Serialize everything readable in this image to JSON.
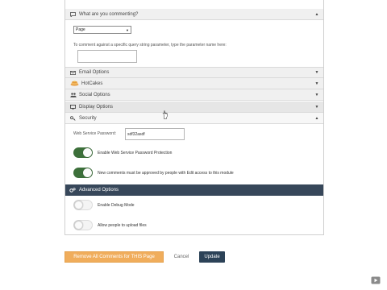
{
  "sections": {
    "commenting": {
      "label": "What are you commenting?",
      "icon": "comment-icon",
      "caret": "▲"
    },
    "email": {
      "label": "Email Options",
      "icon": "envelope-icon",
      "caret": "▼"
    },
    "hotcakes": {
      "label": "HotCakes",
      "icon": "hotcakes-logo-icon",
      "caret": "▼"
    },
    "social": {
      "label": "Social Options",
      "icon": "users-icon",
      "caret": "▼"
    },
    "display": {
      "label": "Display Options",
      "icon": "monitor-icon",
      "caret": "▼"
    },
    "security": {
      "label": "Security",
      "icon": "key-icon",
      "caret": "▲"
    }
  },
  "commenting": {
    "select_value": "Page",
    "help_text": "To comment against a specific query string parameter, type the parameter name here:",
    "param_value": ""
  },
  "security": {
    "password_label": "Web Service Password:",
    "password_value": "sdf32asdf",
    "toggles": [
      {
        "label": "Enable Web Service Password Protection",
        "on": true
      },
      {
        "label": "New comments must be approved by people with Edit access to this module",
        "on": true
      }
    ]
  },
  "advanced": {
    "label": "Advanced Options",
    "icon": "gears-icon",
    "toggles": [
      {
        "label": "Enable Debug Mode",
        "on": false
      },
      {
        "label": "Allow people to upload files",
        "on": false
      }
    ]
  },
  "actions": {
    "remove_label": "Remove All Comments for THIS Page",
    "cancel_label": "Cancel",
    "update_label": "Update"
  },
  "colors": {
    "toggle_on": "#3c6f3a",
    "advanced_bar": "#37475a",
    "remove_button": "#f0ad5c",
    "update_button": "#2c4257"
  }
}
